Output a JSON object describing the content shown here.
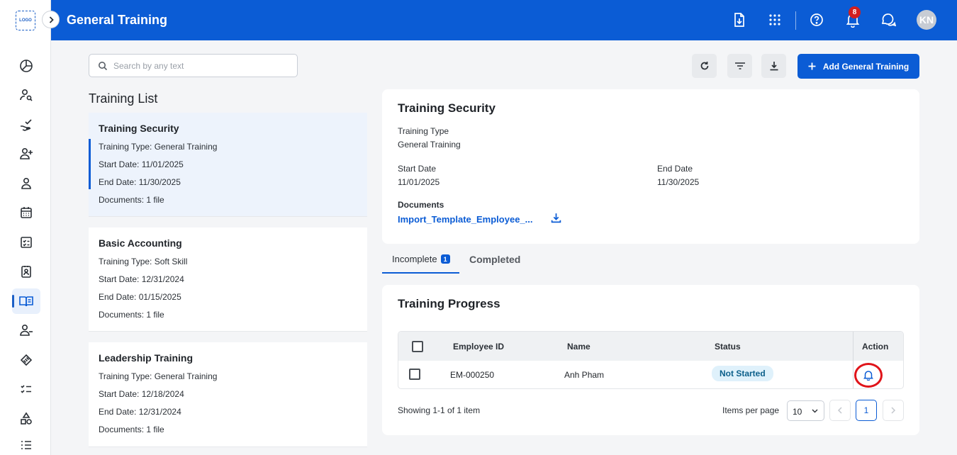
{
  "header": {
    "logo_text": "LOGO",
    "title": "General Training",
    "notification_count": "8",
    "avatar_initials": "KN",
    "icons": [
      "document-download-icon",
      "apps-grid-icon",
      "help-icon",
      "bell-icon",
      "chat-icon"
    ]
  },
  "sidebar": {
    "icons": [
      "pie-chart-icon",
      "user-search-icon",
      "hand-check-icon",
      "user-add-icon",
      "user-icon",
      "calendar-icon",
      "checklist-icon",
      "contact-card-icon",
      "book-open-icon",
      "user-remove-icon",
      "handshake-icon",
      "task-list-icon",
      "shapes-icon",
      "list-icon"
    ],
    "active_index": 8
  },
  "toolbar": {
    "search_placeholder": "Search by any text",
    "search_value": "",
    "add_label": "Add General Training"
  },
  "list": {
    "title": "Training List",
    "items": [
      {
        "name": "Training Security",
        "type": "Training Type: General Training",
        "start": "Start Date: 11/01/2025",
        "end": "End Date: 11/30/2025",
        "docs": "Documents: 1 file",
        "selected": true
      },
      {
        "name": "Basic Accounting",
        "type": "Training Type: Soft Skill",
        "start": "Start Date: 12/31/2024",
        "end": "End Date: 01/15/2025",
        "docs": "Documents: 1 file",
        "selected": false
      },
      {
        "name": "Leadership Training",
        "type": "Training Type: General Training",
        "start": "Start Date: 12/18/2024",
        "end": "End Date: 12/31/2024",
        "docs": "Documents: 1 file",
        "selected": false
      }
    ]
  },
  "detail": {
    "title": "Training Security",
    "type_label": "Training Type",
    "type_value": "General Training",
    "start_label": "Start Date",
    "start_value": "11/01/2025",
    "end_label": "End Date",
    "end_value": "11/30/2025",
    "documents_label": "Documents",
    "document_name": "Import_Template_Employee_..."
  },
  "tabs": {
    "incomplete_label": "Incomplete",
    "incomplete_count": "1",
    "completed_label": "Completed",
    "active": "incomplete"
  },
  "progress": {
    "title": "Training Progress",
    "columns": [
      "Employee ID",
      "Name",
      "Status",
      "Action"
    ],
    "rows": [
      {
        "employee_id": "EM-000250",
        "name": "Anh Pham",
        "status": "Not Started"
      }
    ],
    "showing_text": "Showing 1-1 of 1 item",
    "items_per_page_label": "Items per page",
    "items_per_page_value": "10",
    "current_page": "1"
  },
  "colors": {
    "primary": "#0b5cd5",
    "badge": "#d21f1f",
    "highlight_ring": "#e0141a",
    "status_bg": "#dff1fb"
  }
}
